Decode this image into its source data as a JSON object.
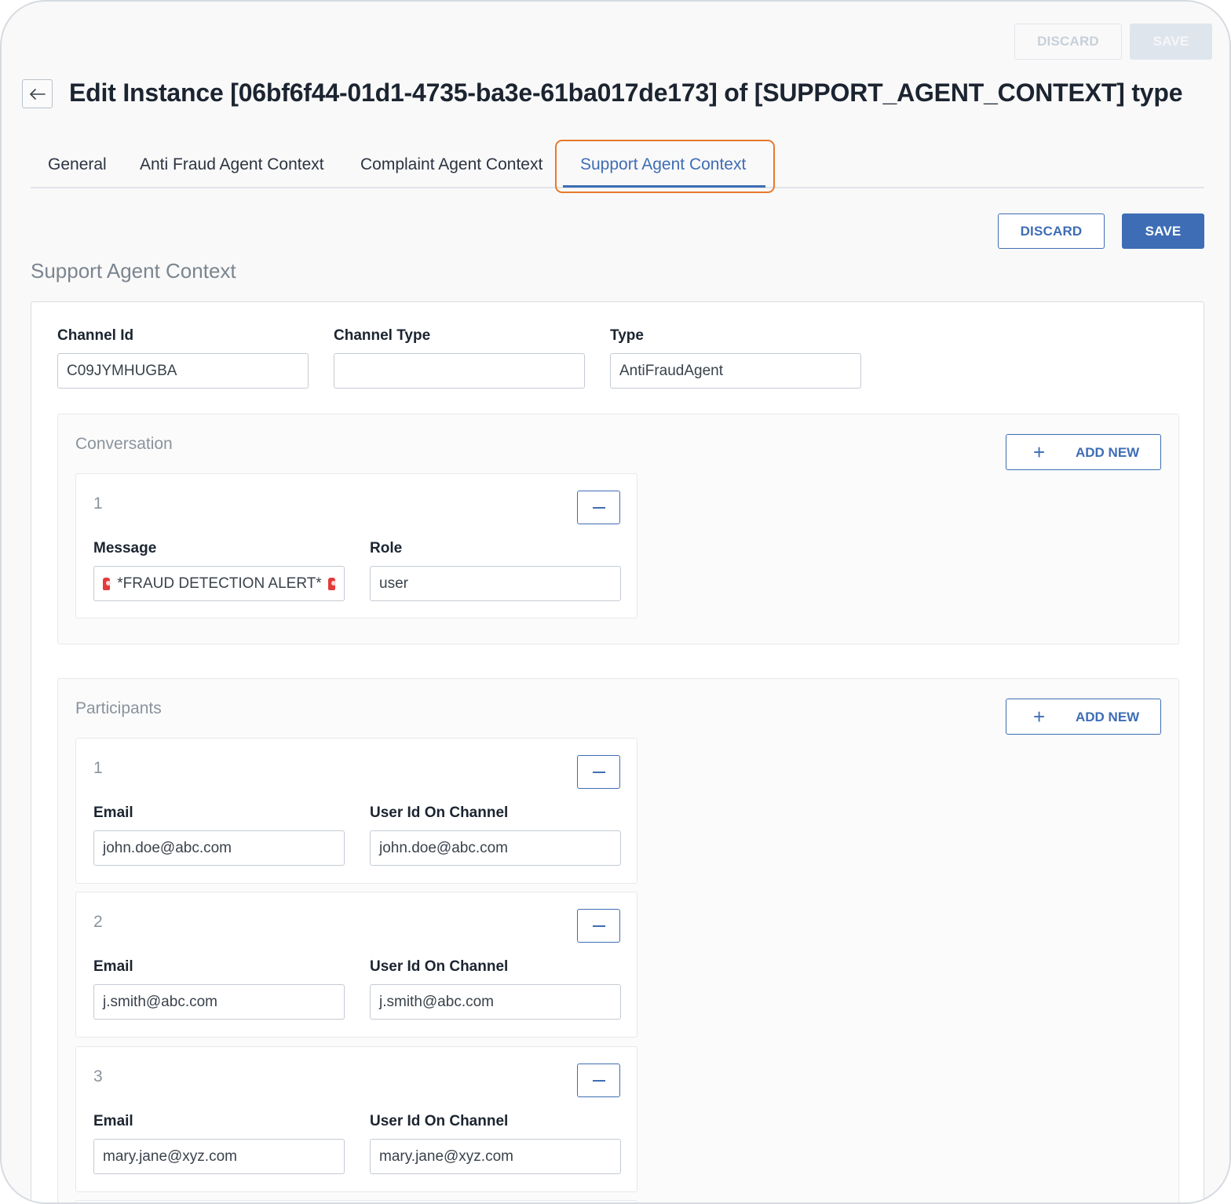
{
  "top_actions": {
    "discard_label": "DISCARD",
    "save_label": "SAVE"
  },
  "header": {
    "back_icon": "arrow-left-icon",
    "title": "Edit Instance [06bf6f44-01d1-4735-ba3e-61ba017de173] of [SUPPORT_AGENT_CONTEXT] type"
  },
  "tabs": [
    {
      "label": "General"
    },
    {
      "label": "Anti Fraud Agent Context"
    },
    {
      "label": "Complaint Agent Context"
    },
    {
      "label": "Support Agent Context",
      "active": true
    }
  ],
  "actions": {
    "discard_label": "DISCARD",
    "save_label": "SAVE"
  },
  "section_title": "Support Agent Context",
  "fields": {
    "channel_id": {
      "label": "Channel Id",
      "value": "C09JYMHUGBA"
    },
    "channel_type": {
      "label": "Channel Type",
      "value": ""
    },
    "type": {
      "label": "Type",
      "value": "AntiFraudAgent"
    }
  },
  "conversation": {
    "title": "Conversation",
    "add_label": "ADD NEW",
    "items": [
      {
        "index": "1",
        "message_label": "Message",
        "message_value": "*FRAUD DETECTION ALERT*",
        "role_label": "Role",
        "role_value": "user"
      }
    ]
  },
  "participants": {
    "title": "Participants",
    "add_label": "ADD NEW",
    "items": [
      {
        "index": "1",
        "email_label": "Email",
        "email_value": "john.doe@abc.com",
        "user_id_label": "User Id On Channel",
        "user_id_value": "john.doe@abc.com"
      },
      {
        "index": "2",
        "email_label": "Email",
        "email_value": "j.smith@abc.com",
        "user_id_label": "User Id On Channel",
        "user_id_value": "j.smith@abc.com"
      },
      {
        "index": "3",
        "email_label": "Email",
        "email_value": "mary.jane@xyz.com",
        "user_id_label": "User Id On Channel",
        "user_id_value": "mary.jane@xyz.com"
      }
    ]
  },
  "colors": {
    "accent": "#3e6db5",
    "highlight": "#e7792b",
    "siren": "#e33a3a"
  }
}
